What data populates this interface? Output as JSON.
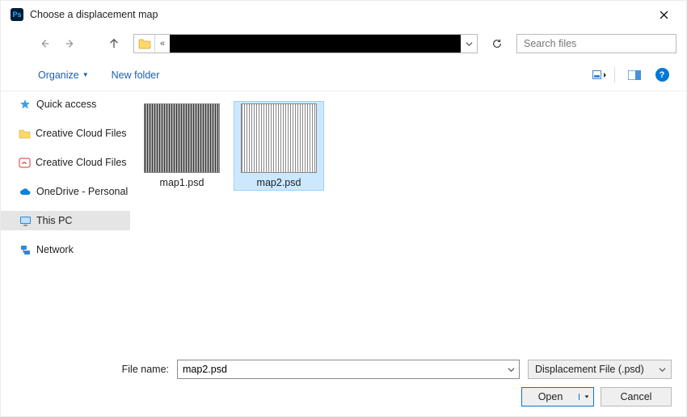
{
  "title": "Choose a displacement map",
  "app_icon_text": "Ps",
  "search": {
    "placeholder": "Search files"
  },
  "toolbar": {
    "organize": "Organize",
    "new_folder": "New folder",
    "help": "?"
  },
  "sidebar": {
    "items": [
      {
        "label": "Quick access"
      },
      {
        "label": "Creative Cloud Files"
      },
      {
        "label": "Creative Cloud Files P"
      },
      {
        "label": "OneDrive - Personal"
      },
      {
        "label": "This PC"
      },
      {
        "label": "Network"
      }
    ]
  },
  "files": [
    {
      "label": "map1.psd"
    },
    {
      "label": "map2.psd"
    }
  ],
  "footer": {
    "filename_label": "File name:",
    "filename_value": "map2.psd",
    "filetype_label": "Displacement File (.psd)",
    "open": "Open",
    "cancel": "Cancel"
  }
}
